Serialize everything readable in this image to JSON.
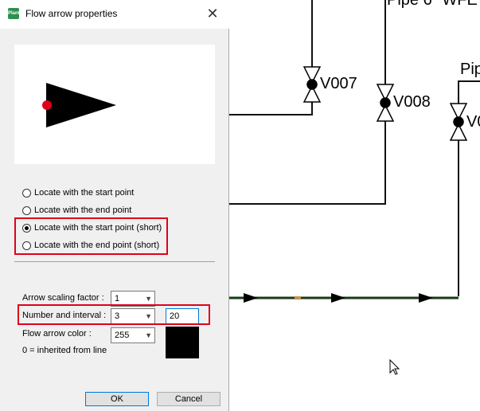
{
  "dialog": {
    "title": "Flow arrow properties",
    "close_glyph": "✕",
    "app_icon_text": "Plant",
    "radios": [
      {
        "label": "Locate with the start point",
        "checked": false
      },
      {
        "label": "Locate with the end point",
        "checked": false
      },
      {
        "label": "Locate with the start point (short)",
        "checked": true
      },
      {
        "label": "Locate with the end point (short)",
        "checked": false
      }
    ],
    "arrow_scaling": {
      "label": "Arrow scaling factor :",
      "value": "1"
    },
    "number_interval": {
      "label": "Number and interval :",
      "number": "3",
      "interval": "20"
    },
    "flow_color": {
      "label": "Flow arrow color :",
      "value": "255",
      "swatch": "#000000"
    },
    "inherited_note": "0 = inherited from line",
    "ok_label": "OK",
    "cancel_label": "Cancel"
  },
  "drawing": {
    "valves": [
      {
        "label": "V007"
      },
      {
        "label": "V008"
      },
      {
        "label": "V0"
      }
    ],
    "pipe_labels": [
      {
        "text": "Pipe 6\" WFE"
      },
      {
        "text": "Pip"
      }
    ],
    "line_color": "#1a3a1a",
    "highlight_color": "#e0001b",
    "accent_color": "#0078d7"
  }
}
